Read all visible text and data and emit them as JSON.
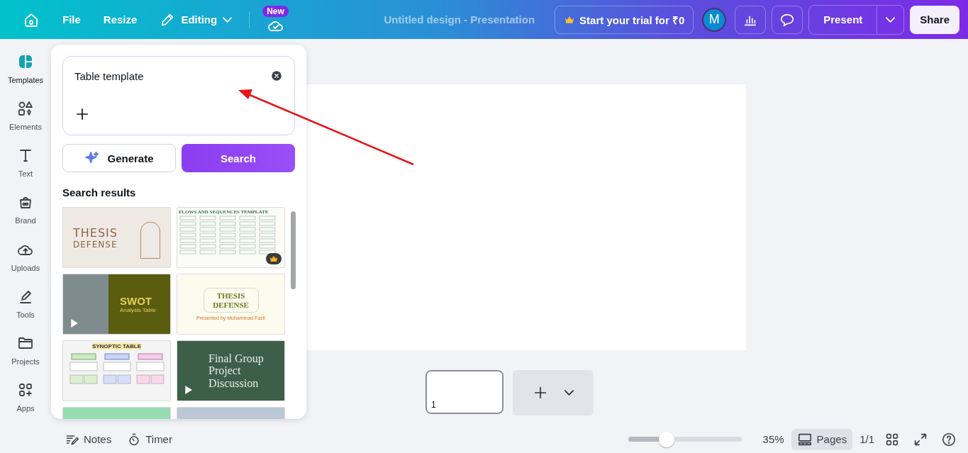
{
  "topbar": {
    "menu": [
      {
        "label": "File"
      },
      {
        "label": "Resize"
      }
    ],
    "mode": "Editing",
    "badge": "New",
    "title": "Untitled design - Presentation",
    "trial": "Start your trial for ₹0",
    "avatar": "M",
    "present": "Present",
    "share": "Share"
  },
  "rail": [
    {
      "kind": "templates",
      "label": "Templates",
      "selected": true
    },
    {
      "kind": "elements",
      "label": "Elements",
      "selected": false
    },
    {
      "kind": "text",
      "label": "Text",
      "selected": false
    },
    {
      "kind": "brand",
      "label": "Brand",
      "selected": false
    },
    {
      "kind": "uploads",
      "label": "Uploads",
      "selected": false
    },
    {
      "kind": "tools",
      "label": "Tools",
      "selected": false
    },
    {
      "kind": "projects",
      "label": "Projects",
      "selected": false
    },
    {
      "kind": "apps",
      "label": "Apps",
      "selected": false
    }
  ],
  "panel": {
    "query": "Table template",
    "generate": "Generate",
    "search": "Search",
    "results_title": "Search results",
    "results": [
      {
        "kind": "thesis",
        "title": "THESIS",
        "subtitle": "DEFENSE",
        "video": false,
        "premium": false
      },
      {
        "kind": "flows",
        "title": "FLOWS AND SEQUENCES TEMPLATE",
        "video": false,
        "premium": true
      },
      {
        "kind": "swot",
        "title": "SWOT",
        "subtitle": "Analysis Table",
        "video": true,
        "premium": false
      },
      {
        "kind": "thesis-green",
        "title": "THESIS DEFENSE",
        "subtitle": "Presented by Muhammad Fazil",
        "video": false,
        "premium": false
      },
      {
        "kind": "synoptic",
        "title": "SYNOPTIC TABLE",
        "video": false,
        "premium": false
      },
      {
        "kind": "final",
        "title": "Final Group Project Discussion",
        "video": true,
        "premium": false
      },
      {
        "kind": "mint",
        "video": false,
        "premium": false
      },
      {
        "kind": "photo",
        "video": false,
        "premium": false
      }
    ]
  },
  "canvas": {
    "page_number": "1"
  },
  "footer": {
    "notes": "Notes",
    "timer": "Timer",
    "zoom": {
      "level": 0.34,
      "reading": "35%"
    },
    "pages": "Pages",
    "count": "1/1"
  }
}
